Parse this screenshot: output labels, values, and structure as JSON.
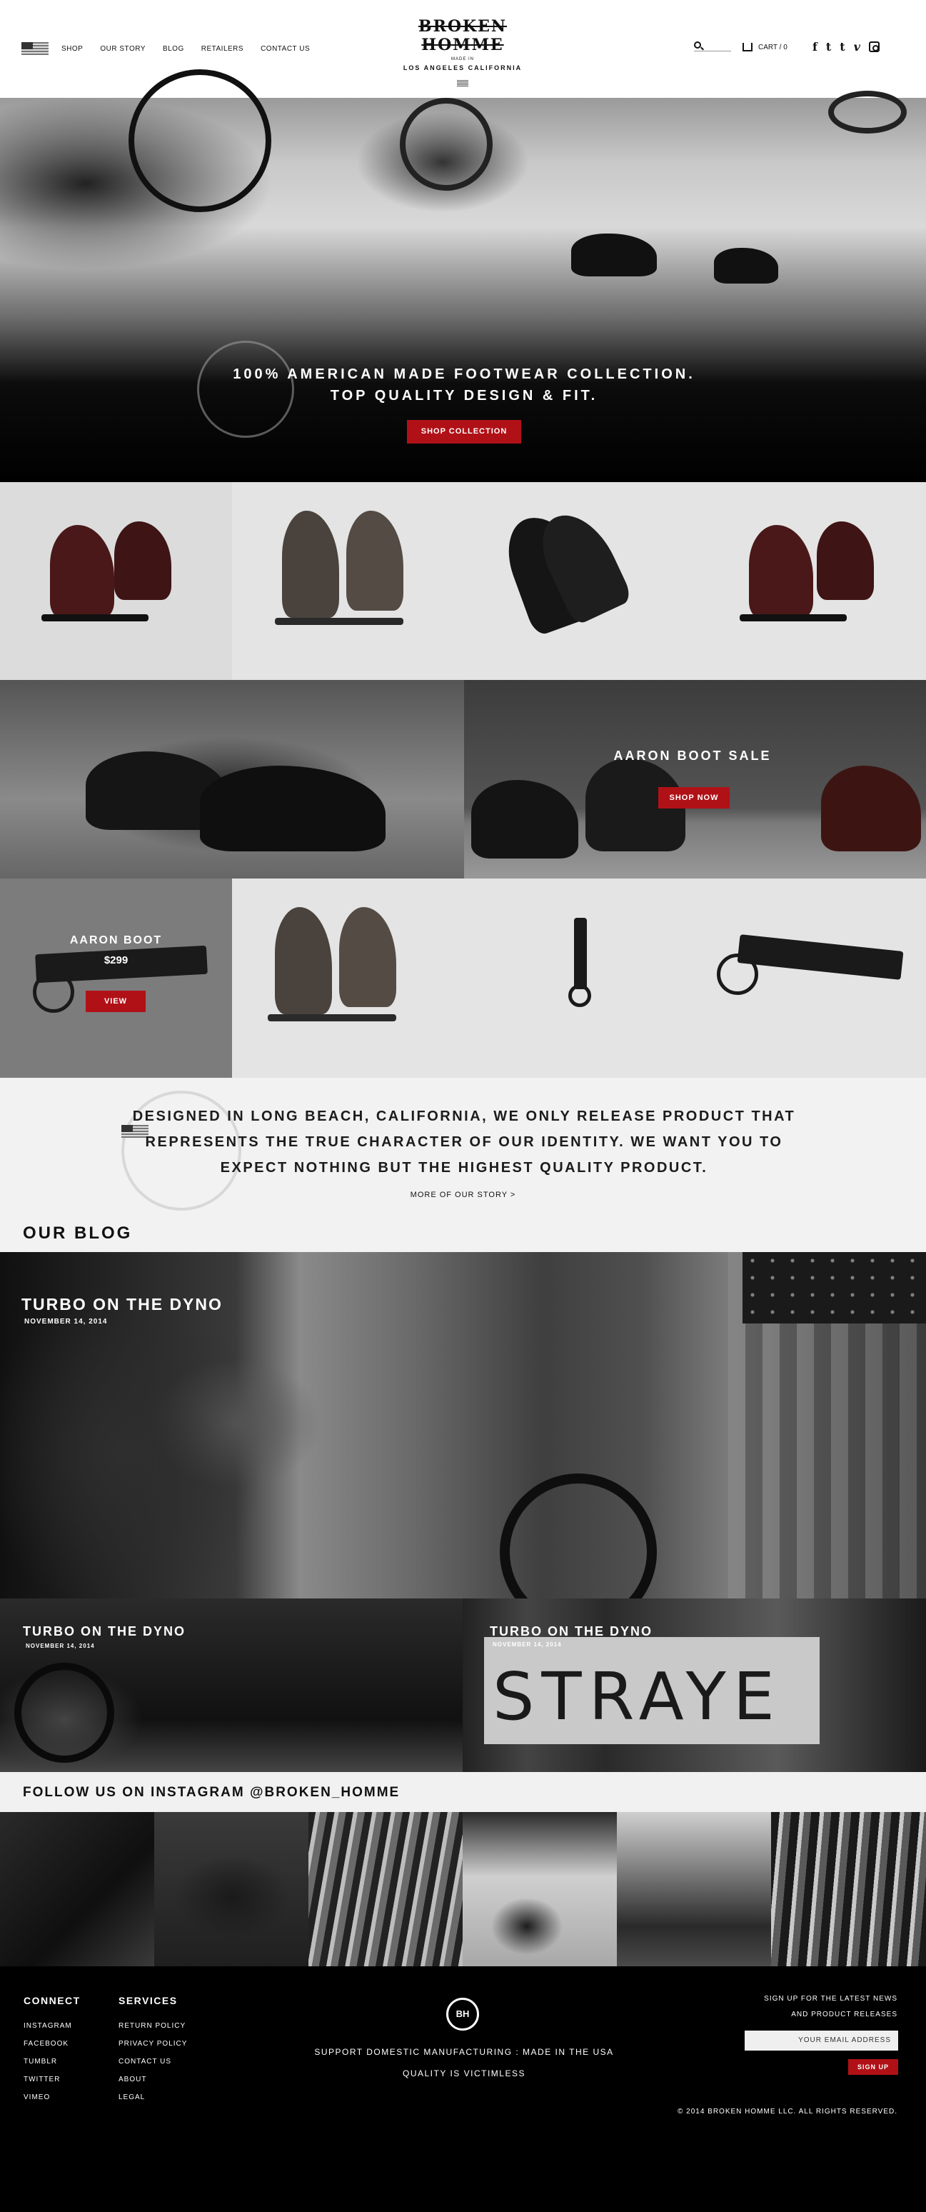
{
  "header": {
    "nav": [
      "SHOP",
      "OUR STORY",
      "BLOG",
      "RETAILERS",
      "CONTACT US"
    ],
    "logo_brand": "BROKEN HOMME",
    "logo_madein": "MADE IN",
    "logo_city": "LOS ANGELES CALIFORNIA",
    "cart_label": "CART / 0",
    "social": [
      "f",
      "t",
      "v"
    ]
  },
  "hero": {
    "line1": "100% AMERICAN MADE FOOTWEAR COLLECTION.",
    "line2": "TOP QUALITY DESIGN & FIT.",
    "button": "SHOP COLLECTION"
  },
  "feature": {
    "title": "AARON BOOT SALE",
    "button": "SHOP NOW"
  },
  "product_feature": {
    "name": "AARON BOOT",
    "price": "$299",
    "button": "VIEW"
  },
  "story": {
    "lines": [
      "DESIGNED IN LONG BEACH, CALIFORNIA, WE ONLY RELEASE PRODUCT THAT",
      "REPRESENTS THE TRUE CHARACTER OF OUR IDENTITY. WE WANT YOU TO",
      "EXPECT NOTHING BUT THE HIGHEST QUALITY PRODUCT."
    ],
    "link": "MORE OF OUR STORY >",
    "blog_heading": "OUR BLOG"
  },
  "blog": {
    "posts": [
      {
        "title": "TURBO ON THE DYNO",
        "date": "NOVEMBER 14, 2014"
      },
      {
        "title": "TURBO ON THE DYNO",
        "date": "NOVEMBER 14, 2014"
      },
      {
        "title": "TURBO ON THE DYNO",
        "date": "NOVEMBER 14, 2014"
      }
    ],
    "sign_text": "STRAYE"
  },
  "instagram": {
    "heading": "FOLLOW US ON INSTAGRAM @BROKEN_HOMME"
  },
  "footer": {
    "connect_heading": "CONNECT",
    "connect_links": [
      "INSTAGRAM",
      "FACEBOOK",
      "TUMBLR",
      "TWITTER",
      "VIMEO"
    ],
    "services_heading": "SERVICES",
    "services_links": [
      "RETURN POLICY",
      "PRIVACY POLICY",
      "CONTACT US",
      "ABOUT",
      "LEGAL"
    ],
    "emblem": "BH",
    "tagline1": "SUPPORT DOMESTIC MANUFACTURING : MADE IN THE USA",
    "tagline2": "QUALITY IS VICTIMLESS",
    "signup_line1": "SIGN UP FOR THE LATEST NEWS",
    "signup_line2": "AND PRODUCT RELEASES",
    "email_placeholder": "YOUR EMAIL ADDRESS",
    "signup_button": "SIGN UP",
    "copyright": "© 2014 BROKEN HOMME LLC. ALL RIGHTS RESERVED."
  },
  "colors": {
    "accent_red": "#b01117",
    "footer_bg": "#000000",
    "tile_gray": "#e4e4e4"
  }
}
